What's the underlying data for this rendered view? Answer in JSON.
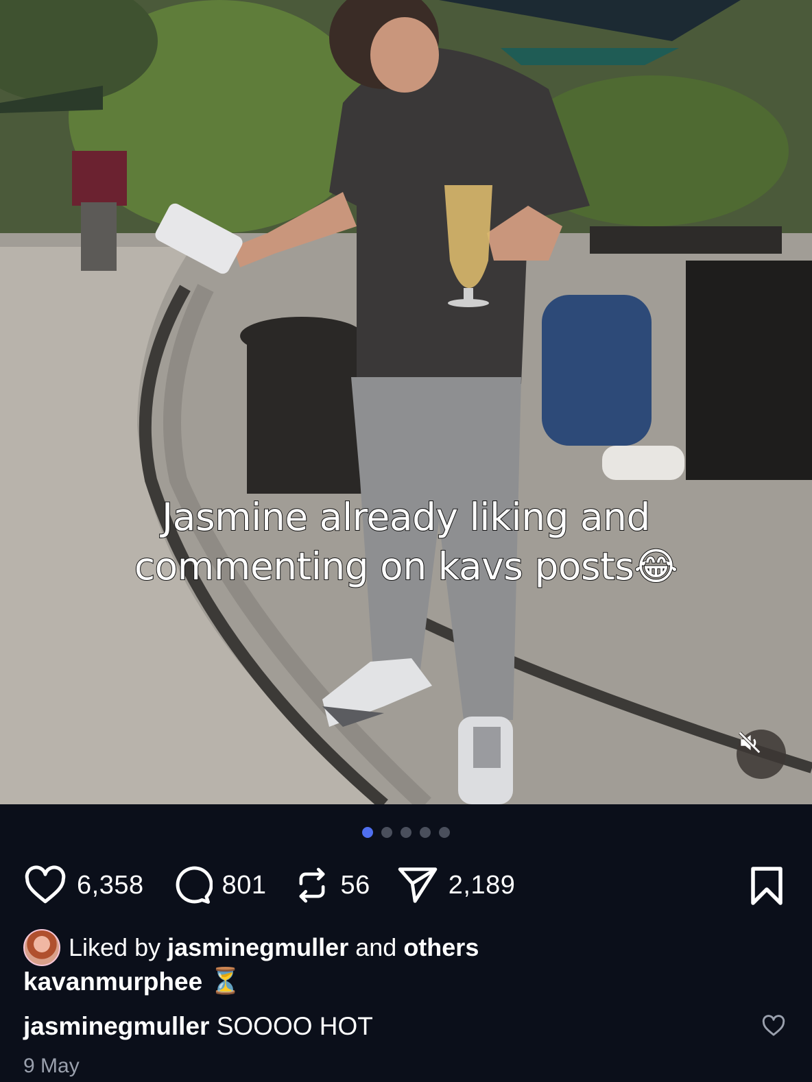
{
  "post": {
    "overlay_text": [
      "Jasmine already liking and",
      "commenting on kavs posts😂"
    ],
    "carousel": {
      "total": 5,
      "active_index": 1
    }
  },
  "actions": {
    "likes": "6,358",
    "comments": "801",
    "reposts": "56",
    "shares": "2,189"
  },
  "liked_by": {
    "prefix": "Liked by",
    "user": "jasminegmuller",
    "and_text": "and",
    "others": "others"
  },
  "caption": {
    "username": "kavanmurphee",
    "emoji": "⏳"
  },
  "comment": {
    "username": "jasminegmuller",
    "text": "SOOOO HOT"
  },
  "date": "9 May",
  "colors": {
    "background": "#0b0f1a",
    "active_dot": "#4f6ff0",
    "inactive_dot": "#4a4f5c",
    "muted_text": "#9aa0ad"
  }
}
